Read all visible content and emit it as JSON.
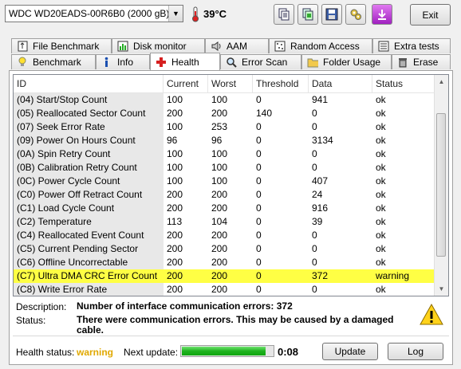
{
  "toolbar": {
    "drive_name": "WDC WD20EADS-00R6B0 (2000 gB)",
    "temperature": "39°C",
    "icons": [
      "copy-text-icon",
      "copy-screen-icon",
      "save-icon",
      "options-icon",
      "download-icon"
    ],
    "exit_label": "Exit"
  },
  "tabs": {
    "row1": [
      {
        "label": "File Benchmark",
        "icon": "file-benchmark-icon"
      },
      {
        "label": "Disk monitor",
        "icon": "disk-monitor-icon"
      },
      {
        "label": "AAM",
        "icon": "speaker-icon"
      },
      {
        "label": "Random Access",
        "icon": "random-access-icon"
      },
      {
        "label": "Extra tests",
        "icon": "extra-tests-icon"
      }
    ],
    "row2": [
      {
        "label": "Benchmark",
        "icon": "bulb-icon"
      },
      {
        "label": "Info",
        "icon": "info-icon"
      },
      {
        "label": "Health",
        "icon": "health-cross-icon"
      },
      {
        "label": "Error Scan",
        "icon": "magnifier-icon"
      },
      {
        "label": "Folder Usage",
        "icon": "folder-icon"
      },
      {
        "label": "Erase",
        "icon": "trash-icon"
      }
    ],
    "active": "Health"
  },
  "table": {
    "headers": [
      "ID",
      "Current",
      "Worst",
      "Threshold",
      "Data",
      "Status"
    ],
    "rows": [
      [
        "(04) Start/Stop Count",
        "100",
        "100",
        "0",
        "941",
        "ok"
      ],
      [
        "(05) Reallocated Sector Count",
        "200",
        "200",
        "140",
        "0",
        "ok"
      ],
      [
        "(07) Seek Error Rate",
        "100",
        "253",
        "0",
        "0",
        "ok"
      ],
      [
        "(09) Power On Hours Count",
        "96",
        "96",
        "0",
        "3134",
        "ok"
      ],
      [
        "(0A) Spin Retry Count",
        "100",
        "100",
        "0",
        "0",
        "ok"
      ],
      [
        "(0B) Calibration Retry Count",
        "100",
        "100",
        "0",
        "0",
        "ok"
      ],
      [
        "(0C) Power Cycle Count",
        "100",
        "100",
        "0",
        "407",
        "ok"
      ],
      [
        "(C0) Power Off Retract Count",
        "200",
        "200",
        "0",
        "24",
        "ok"
      ],
      [
        "(C1) Load Cycle Count",
        "200",
        "200",
        "0",
        "916",
        "ok"
      ],
      [
        "(C2) Temperature",
        "113",
        "104",
        "0",
        "39",
        "ok"
      ],
      [
        "(C4) Reallocated Event Count",
        "200",
        "200",
        "0",
        "0",
        "ok"
      ],
      [
        "(C5) Current Pending Sector",
        "200",
        "200",
        "0",
        "0",
        "ok"
      ],
      [
        "(C6) Offline Uncorrectable",
        "200",
        "200",
        "0",
        "0",
        "ok"
      ],
      [
        "(C7) Ultra DMA CRC Error Count",
        "200",
        "200",
        "0",
        "372",
        "warning"
      ],
      [
        "(C8) Write Error Rate",
        "200",
        "200",
        "0",
        "0",
        "ok"
      ]
    ],
    "highlight_color": "#ffff44"
  },
  "details": {
    "description_label": "Description:",
    "description_value": "Number of interface communication errors: 372",
    "status_label": "Status:",
    "status_value": "There were communication errors. This may be caused by a damaged cable."
  },
  "footer": {
    "health_status_label": "Health status:",
    "health_status_value": "warning",
    "health_status_color": "#e0a800",
    "next_update_label": "Next update:",
    "next_update_progress": 0.92,
    "next_update_time": "0:08",
    "update_button": "Update",
    "log_button": "Log"
  }
}
